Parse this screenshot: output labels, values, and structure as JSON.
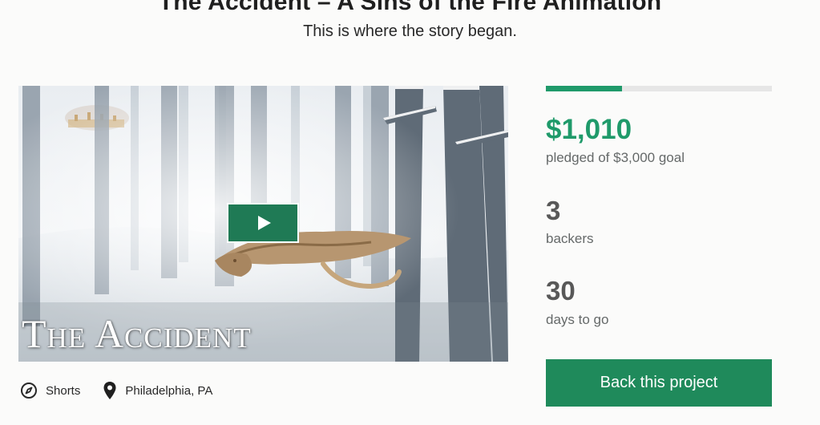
{
  "project": {
    "title": "The Accident – A Sins of the Fire Animation",
    "blurb": "This is where the story began."
  },
  "video": {
    "caption": "The Accident",
    "play_icon": "play-icon"
  },
  "meta": {
    "category": {
      "icon": "compass-icon",
      "label": "Shorts"
    },
    "location": {
      "icon": "map-pin-icon",
      "label": "Philadelphia, PA"
    }
  },
  "stats": {
    "progress_percent": 33.7,
    "pledged": "$1,010",
    "pledged_label": "pledged of $3,000 goal",
    "backers": "3",
    "backers_label": "backers",
    "days": "30",
    "days_label": "days to go"
  },
  "cta": {
    "label": "Back this project"
  },
  "colors": {
    "accent": "#1f9a6a",
    "button": "#1f8a5b",
    "play_button": "#1f7a55"
  }
}
